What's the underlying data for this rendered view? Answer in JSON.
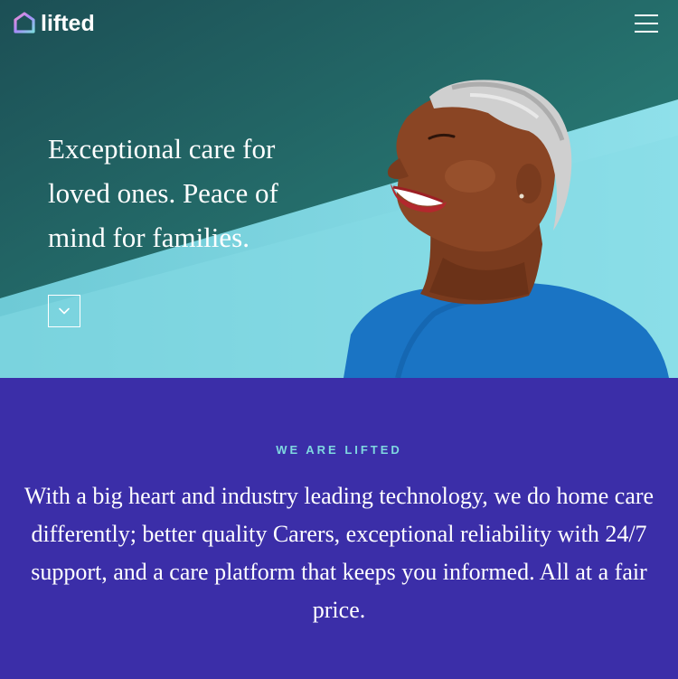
{
  "header": {
    "logo_text": "lifted",
    "logo_icon": "house-outline-icon",
    "menu_icon": "hamburger-menu-icon"
  },
  "hero": {
    "headline": "Exceptional care for loved ones. Peace of mind for families.",
    "scroll_icon": "chevron-down-icon",
    "image": "smiling-older-woman-portrait"
  },
  "about": {
    "eyebrow": "WE ARE LIFTED",
    "body": "With a big heart and industry leading technology, we do home care differently; better quality Carers, exceptional reliability with 24/7 support, and a care platform that keeps you informed. All at a fair price."
  },
  "colors": {
    "hero_dark_teal": "#1f5f5c",
    "hero_light_cyan": "#7fd6e2",
    "section_purple": "#3b2ea8",
    "eyebrow_cyan": "#7fd8e0",
    "text_white": "#ffffff",
    "shirt_blue": "#1a74c4"
  }
}
